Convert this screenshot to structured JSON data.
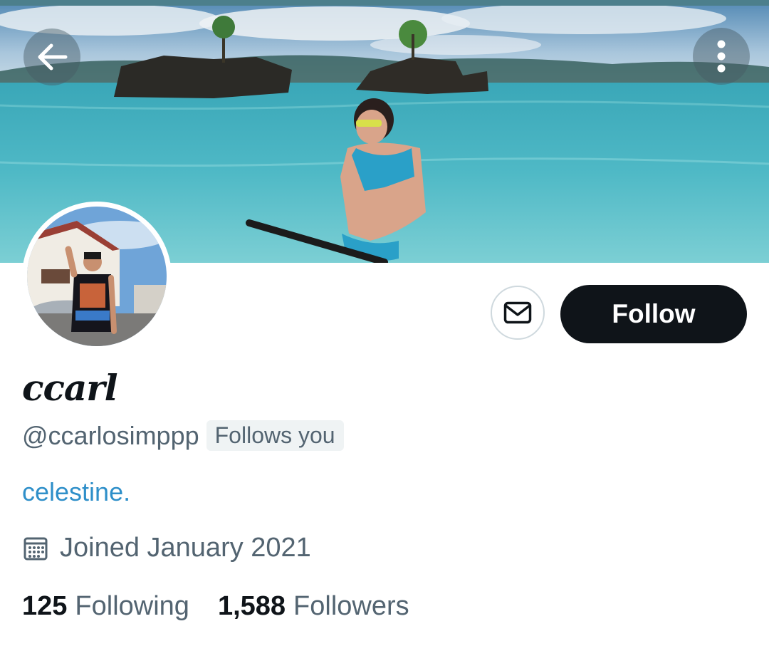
{
  "profile": {
    "display_name": "ccarl",
    "handle": "@ccarlosimppp",
    "follows_you_badge": "Follows you",
    "bio": "celestine.",
    "joined": "Joined January 2021",
    "following_count": "125",
    "following_label": "Following",
    "followers_count": "1,588",
    "followers_label": "Followers"
  },
  "actions": {
    "follow_label": "Follow"
  },
  "icons": {
    "back": "arrow-left-icon",
    "more": "more-vertical-icon",
    "message": "envelope-icon",
    "calendar": "calendar-icon"
  },
  "colors": {
    "follow_button_bg": "#0f1419",
    "bio_link": "#2e8fc9",
    "secondary_text": "#536471"
  }
}
